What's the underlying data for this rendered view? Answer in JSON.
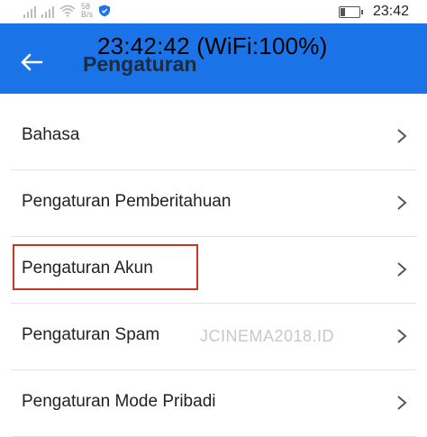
{
  "status_bar": {
    "net_speed_value": "58",
    "net_speed_unit": "B/s",
    "time": "23:42",
    "battery_level": 0.3,
    "icons": [
      "signal-icon",
      "signal-icon",
      "wifi-icon",
      "shield-icon",
      "battery-icon"
    ]
  },
  "overlay": {
    "text": "23:42:42 (WiFi:100%)"
  },
  "appbar": {
    "title": "Pengaturan",
    "back_icon": "back-arrow-icon",
    "color": "#1b73e8"
  },
  "menu": {
    "items": [
      {
        "label": "Bahasa"
      },
      {
        "label": "Pengaturan Pemberitahuan"
      },
      {
        "label": "Pengaturan Akun"
      },
      {
        "label": "Pengaturan Spam"
      },
      {
        "label": "Pengaturan Mode Pribadi"
      }
    ],
    "chevron_icon": "chevron-right-icon",
    "highlight_color": "#c0392b"
  },
  "watermark": {
    "text": "JCINEMA2018.ID"
  }
}
